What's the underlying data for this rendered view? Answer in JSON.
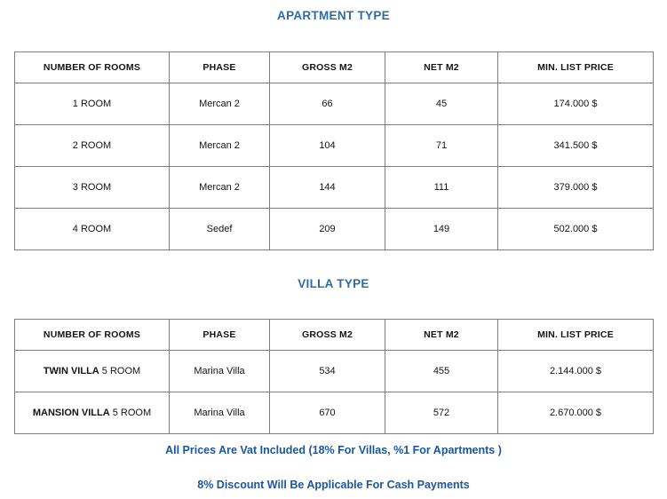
{
  "theme": {
    "title_color": "#2d6ca6",
    "footer_color": "#1b56a0",
    "border_color": "#7d7d7d",
    "background": "#ffffff",
    "text_color": "#141414"
  },
  "apartment_section": {
    "title": "APARTMENT TYPE",
    "columns": [
      "NUMBER OF ROOMS",
      "PHASE",
      "GROSS M2",
      "NET M2",
      "MIN. LIST PRICE"
    ],
    "rows": [
      {
        "rooms": "1 ROOM",
        "phase": "Mercan 2",
        "gross_m2": "66",
        "net_m2": "45",
        "min_list_price": "174.000 $"
      },
      {
        "rooms": "2 ROOM",
        "phase": "Mercan 2",
        "gross_m2": "104",
        "net_m2": "71",
        "min_list_price": "341.500 $"
      },
      {
        "rooms": "3 ROOM",
        "phase": "Mercan 2",
        "gross_m2": "144",
        "net_m2": "111",
        "min_list_price": "379.000 $"
      },
      {
        "rooms": "4 ROOM",
        "phase": "Sedef",
        "gross_m2": "209",
        "net_m2": "149",
        "min_list_price": "502.000 $"
      }
    ]
  },
  "villa_section": {
    "title": "VILLA TYPE",
    "columns": [
      "NUMBER OF ROOMS",
      "PHASE",
      "GROSS M2",
      "NET M2",
      "MIN. LIST PRICE"
    ],
    "rows": [
      {
        "villa_name": "TWIN VILLA",
        "rooms": "5 ROOM",
        "phase": "Marina Villa",
        "gross_m2": "534",
        "net_m2": "455",
        "min_list_price": "2.144.000 $"
      },
      {
        "villa_name": "MANSION VILLA",
        "rooms": "5 ROOM",
        "phase": "Marina Villa",
        "gross_m2": "670",
        "net_m2": "572",
        "min_list_price": "2.670.000 $"
      }
    ]
  },
  "footer": {
    "vat_note": "All Prices Are Vat Included (18% For Villas, %1 For Apartments )",
    "discount_note": "8% Discount Will Be Applicable For Cash Payments"
  }
}
